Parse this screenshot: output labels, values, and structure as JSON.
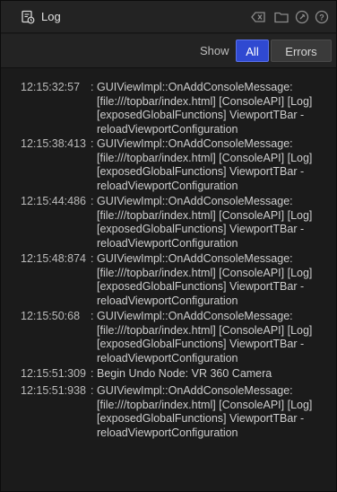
{
  "window": {
    "title": "Log"
  },
  "toolbar": {
    "show_label": "Show",
    "filters": [
      {
        "label": "All",
        "selected": true
      },
      {
        "label": "Errors",
        "selected": false
      }
    ]
  },
  "titlebar_icons": [
    "clear-icon",
    "folder-icon",
    "pin-icon",
    "help-icon"
  ],
  "colors": {
    "accent": "#2f49d1",
    "background": "#1b1b1b",
    "bar": "#232323"
  },
  "entries": [
    {
      "time": "12:15:32:57",
      "sep": ":",
      "message": "GUIViewImpl::OnAddConsoleMessage:\n[file:///topbar/index.html] [ConsoleAPI] [Log]\n[exposedGlobalFunctions] ViewportTBar -\nreloadViewportConfiguration"
    },
    {
      "time": "12:15:38:413",
      "sep": ":",
      "message": "GUIViewImpl::OnAddConsoleMessage:\n[file:///topbar/index.html] [ConsoleAPI] [Log]\n[exposedGlobalFunctions] ViewportTBar -\nreloadViewportConfiguration"
    },
    {
      "time": "12:15:44:486",
      "sep": ":",
      "message": "GUIViewImpl::OnAddConsoleMessage:\n[file:///topbar/index.html] [ConsoleAPI] [Log]\n[exposedGlobalFunctions] ViewportTBar -\nreloadViewportConfiguration"
    },
    {
      "time": "12:15:48:874",
      "sep": ":",
      "message": "GUIViewImpl::OnAddConsoleMessage:\n[file:///topbar/index.html] [ConsoleAPI] [Log]\n[exposedGlobalFunctions] ViewportTBar -\nreloadViewportConfiguration"
    },
    {
      "time": "12:15:50:68",
      "sep": ":",
      "message": "GUIViewImpl::OnAddConsoleMessage:\n[file:///topbar/index.html] [ConsoleAPI] [Log]\n[exposedGlobalFunctions] ViewportTBar -\nreloadViewportConfiguration"
    },
    {
      "time": "12:15:51:309",
      "sep": ":",
      "message": "Begin Undo Node: VR 360 Camera"
    },
    {
      "time": "12:15:51:938",
      "sep": ":",
      "message": "GUIViewImpl::OnAddConsoleMessage:\n[file:///topbar/index.html] [ConsoleAPI] [Log]\n[exposedGlobalFunctions] ViewportTBar -\nreloadViewportConfiguration"
    }
  ]
}
